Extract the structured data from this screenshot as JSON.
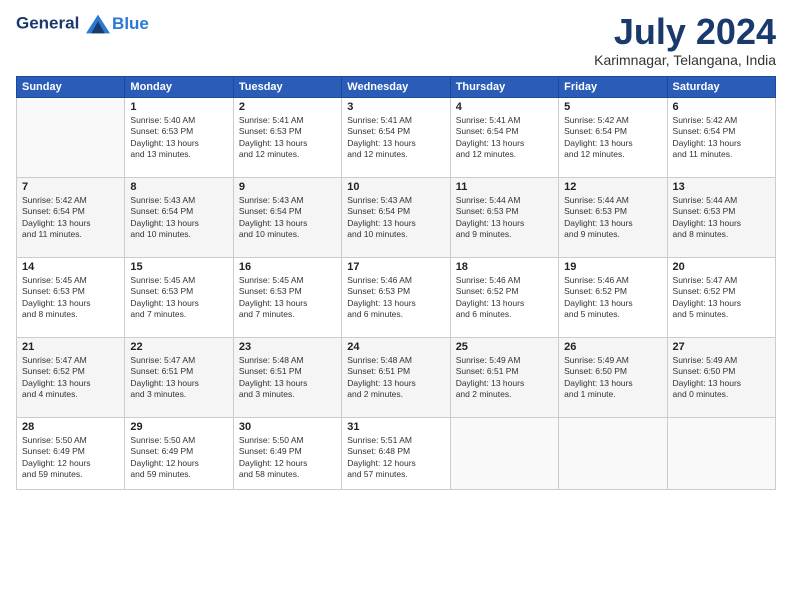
{
  "header": {
    "logo_line1": "General",
    "logo_line2": "Blue",
    "month_year": "July 2024",
    "location": "Karimnagar, Telangana, India"
  },
  "days_of_week": [
    "Sunday",
    "Monday",
    "Tuesday",
    "Wednesday",
    "Thursday",
    "Friday",
    "Saturday"
  ],
  "weeks": [
    [
      {
        "day": "",
        "info": ""
      },
      {
        "day": "1",
        "info": "Sunrise: 5:40 AM\nSunset: 6:53 PM\nDaylight: 13 hours\nand 13 minutes."
      },
      {
        "day": "2",
        "info": "Sunrise: 5:41 AM\nSunset: 6:53 PM\nDaylight: 13 hours\nand 12 minutes."
      },
      {
        "day": "3",
        "info": "Sunrise: 5:41 AM\nSunset: 6:54 PM\nDaylight: 13 hours\nand 12 minutes."
      },
      {
        "day": "4",
        "info": "Sunrise: 5:41 AM\nSunset: 6:54 PM\nDaylight: 13 hours\nand 12 minutes."
      },
      {
        "day": "5",
        "info": "Sunrise: 5:42 AM\nSunset: 6:54 PM\nDaylight: 13 hours\nand 12 minutes."
      },
      {
        "day": "6",
        "info": "Sunrise: 5:42 AM\nSunset: 6:54 PM\nDaylight: 13 hours\nand 11 minutes."
      }
    ],
    [
      {
        "day": "7",
        "info": "Sunrise: 5:42 AM\nSunset: 6:54 PM\nDaylight: 13 hours\nand 11 minutes."
      },
      {
        "day": "8",
        "info": "Sunrise: 5:43 AM\nSunset: 6:54 PM\nDaylight: 13 hours\nand 10 minutes."
      },
      {
        "day": "9",
        "info": "Sunrise: 5:43 AM\nSunset: 6:54 PM\nDaylight: 13 hours\nand 10 minutes."
      },
      {
        "day": "10",
        "info": "Sunrise: 5:43 AM\nSunset: 6:54 PM\nDaylight: 13 hours\nand 10 minutes."
      },
      {
        "day": "11",
        "info": "Sunrise: 5:44 AM\nSunset: 6:53 PM\nDaylight: 13 hours\nand 9 minutes."
      },
      {
        "day": "12",
        "info": "Sunrise: 5:44 AM\nSunset: 6:53 PM\nDaylight: 13 hours\nand 9 minutes."
      },
      {
        "day": "13",
        "info": "Sunrise: 5:44 AM\nSunset: 6:53 PM\nDaylight: 13 hours\nand 8 minutes."
      }
    ],
    [
      {
        "day": "14",
        "info": "Sunrise: 5:45 AM\nSunset: 6:53 PM\nDaylight: 13 hours\nand 8 minutes."
      },
      {
        "day": "15",
        "info": "Sunrise: 5:45 AM\nSunset: 6:53 PM\nDaylight: 13 hours\nand 7 minutes."
      },
      {
        "day": "16",
        "info": "Sunrise: 5:45 AM\nSunset: 6:53 PM\nDaylight: 13 hours\nand 7 minutes."
      },
      {
        "day": "17",
        "info": "Sunrise: 5:46 AM\nSunset: 6:53 PM\nDaylight: 13 hours\nand 6 minutes."
      },
      {
        "day": "18",
        "info": "Sunrise: 5:46 AM\nSunset: 6:52 PM\nDaylight: 13 hours\nand 6 minutes."
      },
      {
        "day": "19",
        "info": "Sunrise: 5:46 AM\nSunset: 6:52 PM\nDaylight: 13 hours\nand 5 minutes."
      },
      {
        "day": "20",
        "info": "Sunrise: 5:47 AM\nSunset: 6:52 PM\nDaylight: 13 hours\nand 5 minutes."
      }
    ],
    [
      {
        "day": "21",
        "info": "Sunrise: 5:47 AM\nSunset: 6:52 PM\nDaylight: 13 hours\nand 4 minutes."
      },
      {
        "day": "22",
        "info": "Sunrise: 5:47 AM\nSunset: 6:51 PM\nDaylight: 13 hours\nand 3 minutes."
      },
      {
        "day": "23",
        "info": "Sunrise: 5:48 AM\nSunset: 6:51 PM\nDaylight: 13 hours\nand 3 minutes."
      },
      {
        "day": "24",
        "info": "Sunrise: 5:48 AM\nSunset: 6:51 PM\nDaylight: 13 hours\nand 2 minutes."
      },
      {
        "day": "25",
        "info": "Sunrise: 5:49 AM\nSunset: 6:51 PM\nDaylight: 13 hours\nand 2 minutes."
      },
      {
        "day": "26",
        "info": "Sunrise: 5:49 AM\nSunset: 6:50 PM\nDaylight: 13 hours\nand 1 minute."
      },
      {
        "day": "27",
        "info": "Sunrise: 5:49 AM\nSunset: 6:50 PM\nDaylight: 13 hours\nand 0 minutes."
      }
    ],
    [
      {
        "day": "28",
        "info": "Sunrise: 5:50 AM\nSunset: 6:49 PM\nDaylight: 12 hours\nand 59 minutes."
      },
      {
        "day": "29",
        "info": "Sunrise: 5:50 AM\nSunset: 6:49 PM\nDaylight: 12 hours\nand 59 minutes."
      },
      {
        "day": "30",
        "info": "Sunrise: 5:50 AM\nSunset: 6:49 PM\nDaylight: 12 hours\nand 58 minutes."
      },
      {
        "day": "31",
        "info": "Sunrise: 5:51 AM\nSunset: 6:48 PM\nDaylight: 12 hours\nand 57 minutes."
      },
      {
        "day": "",
        "info": ""
      },
      {
        "day": "",
        "info": ""
      },
      {
        "day": "",
        "info": ""
      }
    ]
  ]
}
